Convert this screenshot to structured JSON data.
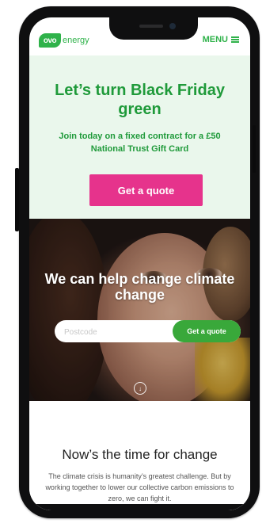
{
  "brand": {
    "logo_mark": "ovo",
    "logo_text": "energy",
    "accent": "#2fb24a",
    "cta_pink": "#e6338c",
    "input_button_green": "#39a83a"
  },
  "nav": {
    "menu_label": "MENU",
    "menu_icon": "hamburger-icon"
  },
  "hero": {
    "headline": "Let’s turn Black Friday green",
    "subline": "Join today on a fixed contract for a £50 National Trust Gift Card",
    "cta_label": "Get a quote"
  },
  "photo_section": {
    "title": "We can help change climate change",
    "postcode_placeholder": "Postcode",
    "postcode_button_label": "Get a quote",
    "scroll_icon": "chevron-down-icon",
    "scroll_glyph": "↓"
  },
  "content": {
    "title": "Now’s the time for change",
    "paragraph": "The climate crisis is humanity’s greatest challenge. But by working together to lower our collective carbon emissions to zero, we can fight it."
  }
}
